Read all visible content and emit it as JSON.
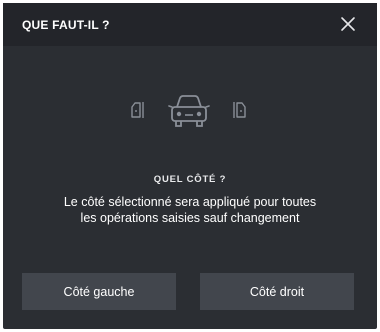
{
  "dialog": {
    "title": "QUE FAUT-IL ?",
    "close_icon": "close-icon",
    "icons": [
      "door-left-icon",
      "car-front-icon",
      "door-right-icon"
    ],
    "question": "QUEL CÔTÉ ?",
    "description": "Le côté sélectionné sera appliqué pour toutes les opérations saisies sauf changement",
    "buttons": {
      "left_label": "Côté gauche",
      "right_label": "Côté droit"
    },
    "colors": {
      "background": "#2b2e33",
      "header": "#23252a",
      "button": "#42464d",
      "icon": "#8a8f98"
    }
  }
}
